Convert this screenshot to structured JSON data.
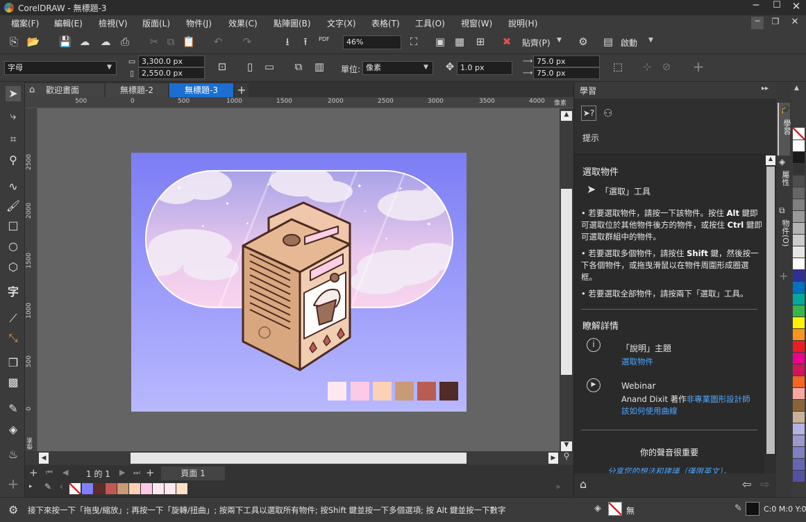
{
  "window": {
    "title": "CorelDRAW - 無標題-3",
    "app_name": "CorelDRAW"
  },
  "menu": [
    "檔案(F)",
    "編輯(E)",
    "檢視(V)",
    "版面(L)",
    "物件(J)",
    "效果(C)",
    "點陣圖(B)",
    "文字(X)",
    "表格(T)",
    "工具(O)",
    "視窗(W)",
    "說明(H)"
  ],
  "toolbar": {
    "zoom": "46%",
    "snap_label": "貼齊(P)",
    "launch_label": "啟動",
    "pdf_label": "PDF"
  },
  "propbar": {
    "preset": "字母",
    "width": "3,300.0 px",
    "height": "2,550.0 px",
    "unit_label": "單位:",
    "unit_value": "像素",
    "nudge": "1.0 px",
    "dup_x": "75.0 px",
    "dup_y": "75.0 px"
  },
  "doc_tabs": {
    "welcome": "歡迎畫面",
    "tab2": "無標題-2",
    "tab3": "無標題-3"
  },
  "rulers": {
    "h_labels": [
      "500",
      "0",
      "500",
      "1000",
      "1500",
      "2000",
      "2500",
      "3000",
      "3500",
      "4000"
    ],
    "h_unit": "像素",
    "v_labels": [
      "2500",
      "2000",
      "1500",
      "1000",
      "500",
      "0"
    ],
    "v_unit": "像素"
  },
  "page_nav": {
    "page_of": "1 的 1",
    "page_label": "頁面 1"
  },
  "swatches": [
    "#fde8f0",
    "#fcc9e6",
    "#fdd1b5",
    "#c99a76",
    "#bb5c53",
    "#512b25"
  ],
  "palette_bottom": [
    "#8080ff",
    "#5a2d2a",
    "#c05a50",
    "#c99a76",
    "#fdd1b5",
    "#fcc9e6",
    "#fde8f0",
    "#fde8f0",
    "#ffe0c8"
  ],
  "docker": {
    "header": "學習",
    "hints_label": "提示",
    "section1_title": "選取物件",
    "tool_label": "「選取」工具",
    "bullets": [
      {
        "text_parts": [
          "若要選取物件，請按一下該物件。按住 ",
          "Alt",
          " 鍵即可選取位於其他物件後方的物件，或按住 ",
          "Ctrl",
          " 鍵即可選取群組中的物件。"
        ]
      },
      {
        "text_parts": [
          "若要選取多個物件，請按住 ",
          "Shift",
          " 鍵，然後按一下各個物件，或拖曳滑鼠以在物件周圍形成圈選框。"
        ]
      },
      {
        "text_parts": [
          "若要選取全部物件，請按兩下「選取」工具。"
        ]
      }
    ],
    "learn_more_title": "瞭解詳情",
    "help_title": "「說明」主題",
    "help_link": "選取物件",
    "webinar_title": "Webinar",
    "webinar_author": "Anand Dixit 著作",
    "webinar_link": "非專業圖形設計師該如何使用曲線",
    "feedback_title": "你的聲音很重要",
    "feedback_link": "分享您的想法和建議（僅限英文）。"
  },
  "docker_side_tabs": [
    "學習",
    "屬性",
    "物件(O)"
  ],
  "color_strip": [
    "#ffffff",
    "#1a1a1a",
    "#333333",
    "#4d4d4d",
    "#666666",
    "#808080",
    "#999999",
    "#b3b3b3",
    "#cccccc",
    "#e6e6e6",
    "#ffffff",
    "#2e3192",
    "#0071bc",
    "#00a99d",
    "#39b54a",
    "#fff200",
    "#f7941d",
    "#ed1c24",
    "#ec008c",
    "#d4145a",
    "#f26522",
    "#f9a8a0",
    "#8c6239",
    "#c7b299",
    "#b3b3e6",
    "#9999cc",
    "#8080c0",
    "#6666b3",
    "#5252a3",
    "#3d3d8c"
  ],
  "status": {
    "hint": "接下來按一下「拖曳/縮放」; 再按一下「旋轉/扭曲」; 按兩下工具以選取所有物件; 按Shift 鍵並按一下多個選項; 按 Alt 鍵並按一下數字",
    "fill_label": "無",
    "color_readout": "C:0 M:0 Y:0"
  }
}
